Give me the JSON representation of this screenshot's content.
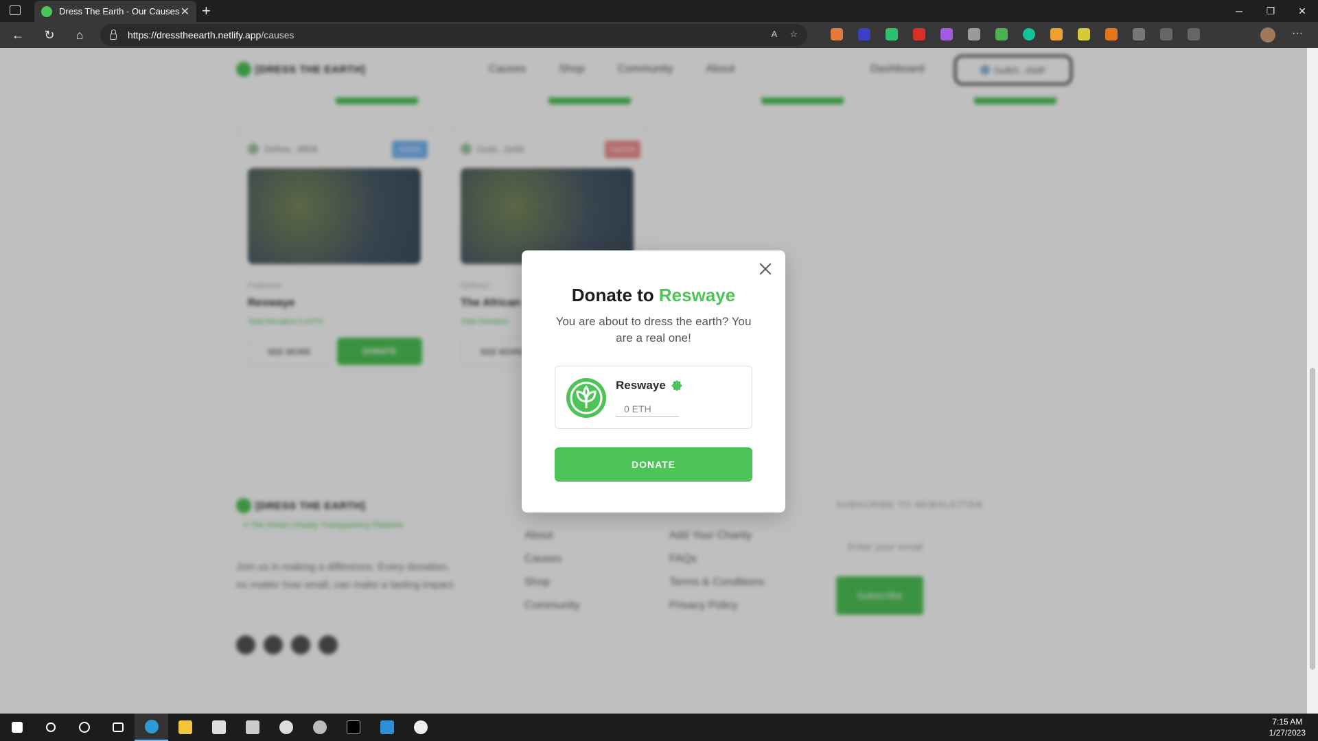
{
  "browser": {
    "tab_title": "Dress The Earth - Our Causes",
    "close_tab": "✕",
    "new_tab": "+",
    "url_host": "https://dresstheearth.netlify.app",
    "url_path": "/causes",
    "read_aloud": "A",
    "favorite": "☆"
  },
  "site": {
    "brand": "[DRESS THE EARTH]",
    "nav": [
      "Causes",
      "Shop",
      "Community",
      "About"
    ],
    "dashboard": "Dashboard",
    "wallet": "0xdb5...00dF"
  },
  "cards": [
    {
      "owner": "0xRee...9858",
      "badge": "Active",
      "badge_color": "#7bb6f5",
      "kind": "Featured",
      "name": "Reswaye",
      "total": "Total Donation 0.14TH",
      "see_more": "SEE MORE",
      "donate": "DONATE"
    },
    {
      "owner": "0xdd...2e08",
      "badge": "Inactive",
      "badge_color": "#f08f8f",
      "kind": "Defunct",
      "name": "The African",
      "total": "Total Donation",
      "see_more": "SEE MORE"
    }
  ],
  "footer": {
    "brand": "[DRESS THE EARTH]",
    "tagline": "# The Green Charity Transparency Platform",
    "blurb": "Join us in making a difference. Every donation, no matter how small, can make a lasting impact.",
    "col1": [
      "About",
      "Causes",
      "Shop",
      "Community"
    ],
    "col2": [
      "Add Your Charity",
      "FAQs",
      "Terms & Conditions",
      "Privacy Policy"
    ],
    "newsletter_heading": "SUBSCRIBE TO NEWSLETTER",
    "email_placeholder": "Enter your email",
    "subscribe": "Subscribe"
  },
  "modal": {
    "title_prefix": "Donate to",
    "title_name": "Reswaye",
    "subtitle": "You are about to dress the earth? You are a real one!",
    "charity_name": "Reswaye",
    "amount_placeholder": "0 ETH",
    "donate_label": "DONATE"
  },
  "taskbar": {
    "time": "7:15 AM",
    "date": "1/27/2023"
  },
  "colors": {
    "accent": "#4ec357"
  }
}
